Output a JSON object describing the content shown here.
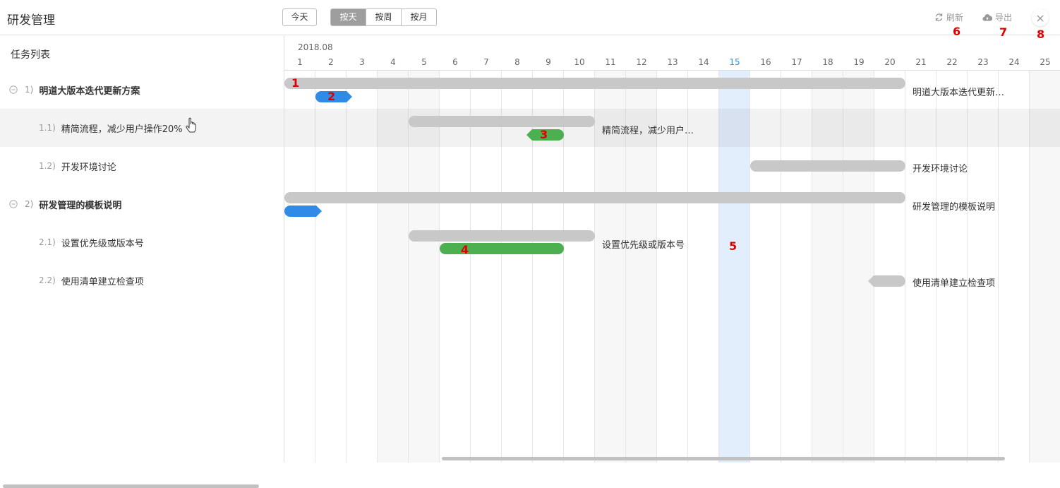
{
  "header": {
    "title": "研发管理",
    "today_label": "今天",
    "views": [
      {
        "label": "按天",
        "active": true
      },
      {
        "label": "按周",
        "active": false
      },
      {
        "label": "按月",
        "active": false
      }
    ],
    "refresh_label": "刷新",
    "export_label": "导出",
    "close_icon": "close-icon"
  },
  "annotations": [
    "1",
    "2",
    "3",
    "4",
    "5",
    "6",
    "7",
    "8"
  ],
  "task_list": {
    "title": "任务列表",
    "tasks": [
      {
        "num": "1)",
        "name": "明道大版本迭代更新方案",
        "parent": true
      },
      {
        "num": "1.1)",
        "name": "精简流程，减少用户操作20%",
        "parent": false
      },
      {
        "num": "1.2)",
        "name": "开发环境讨论",
        "parent": false
      },
      {
        "num": "2)",
        "name": "研发管理的模板说明",
        "parent": true
      },
      {
        "num": "2.1)",
        "name": "设置优先级或版本号",
        "parent": false
      },
      {
        "num": "2.2)",
        "name": "使用清单建立检查项",
        "parent": false
      }
    ]
  },
  "timeline": {
    "month": "2018.08",
    "days": [
      "1",
      "2",
      "3",
      "4",
      "5",
      "6",
      "7",
      "8",
      "9",
      "10",
      "11",
      "12",
      "13",
      "14",
      "15",
      "16",
      "17",
      "18",
      "19",
      "20",
      "21",
      "22",
      "23",
      "24",
      "25"
    ],
    "today_day": "15"
  },
  "bar_labels": [
    "明道大版本迭代更新…",
    "精简流程，减少用户…",
    "开发环境讨论",
    "研发管理的模板说明",
    "设置优先级或版本号",
    "使用清单建立检查项"
  ],
  "colors": {
    "accent_blue": "#2f8be6",
    "progress_green": "#4caf50",
    "bar_gray": "#c8c8c8",
    "today_highlight": "#e3eefc",
    "annotation_red": "#e10000"
  }
}
